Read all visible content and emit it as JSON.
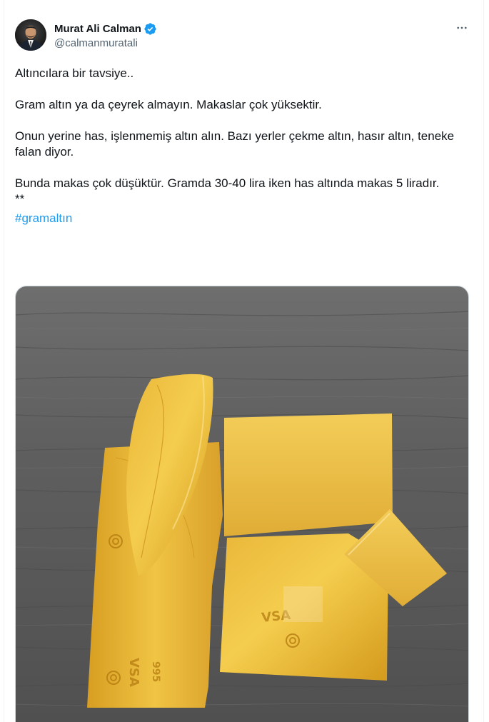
{
  "author": {
    "display_name": "Murat Ali Calman",
    "handle": "@calmanmuratali",
    "verified": true,
    "verified_icon": "verified-badge-icon",
    "accent_color": "#1d9bf0"
  },
  "more_icon": "more-horizontal-icon",
  "tweet": {
    "line1": "Altıncılara bir tavsiye..",
    "line2": "Gram altın ya da çeyrek almayın. Makaslar çok yüksektir.",
    "line3": "Onun yerine has, işlenmemiş altın alın. Bazı yerler çekme altın, hasır altın, teneke falan diyor.",
    "line4": "Bunda makas çok düşüktür. Gramda 30-40 lira iken has altında makas 5 liradır.",
    "line5": "**",
    "hashtag": "#gramaltın"
  },
  "media": {
    "type": "photo",
    "subject": "gold-leaf-pieces-on-wood-table",
    "stamp_text_1": "VSA",
    "stamp_text_2": "995"
  }
}
